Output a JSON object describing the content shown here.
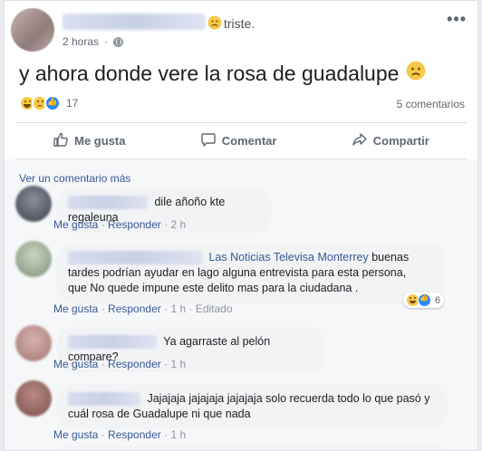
{
  "post": {
    "feeling": "triste.",
    "time": "2 horas",
    "text": "y ahora donde vere la rosa de guadalupe",
    "reaction_count": "17",
    "comment_count": "5 comentarios"
  },
  "actions": {
    "like": "Me gusta",
    "comment": "Comentar",
    "share": "Compartir"
  },
  "view_more": "Ver un comentario más",
  "comments": [
    {
      "text": "dile añoño kte regaleuna",
      "like": "Me gusta",
      "reply": "Responder",
      "time": "2 h"
    },
    {
      "mention": "Las Noticias Televisa Monterrey",
      "text_line1": "buenas",
      "text_line2": "tardes podrían ayudar en lago alguna entrevista para esta persona,",
      "text_line3": "que No quede impune este delito mas para la ciudadana .",
      "like": "Me gusta",
      "reply": "Responder",
      "time": "1 h",
      "edited": "Editado",
      "reaction_count": "6"
    },
    {
      "text": "Ya agarraste al pelón compare?",
      "like": "Me gusta",
      "reply": "Responder",
      "time": "1 h"
    },
    {
      "text_line1": "Jajajaja jajajaja jajajaja solo recuerda todo lo que pasó y",
      "text_line2": "cuál rosa de Guadalupe ni que nada",
      "like": "Me gusta",
      "reply": "Responder",
      "time": "1 h"
    }
  ],
  "colors": {
    "link": "#385898",
    "like_blue": "#2d88ff",
    "emoji_yellow": "#f7c746",
    "bubble_bg": "#f2f3f5"
  },
  "icons": [
    "sad-emoji-icon",
    "globe-icon",
    "more-options-icon",
    "thumbs-up-icon",
    "comment-icon",
    "share-icon",
    "haha-reaction-icon",
    "sad-reaction-icon",
    "like-reaction-icon"
  ]
}
